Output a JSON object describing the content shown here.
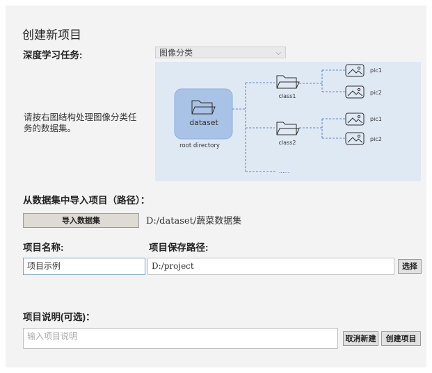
{
  "page_title": "创建新项目",
  "task": {
    "label": "深度学习任务:",
    "selected": "图像分类"
  },
  "hint_text_line1": "请按右图结构处理图像分类任",
  "hint_text_line2": "务的数据集。",
  "diagram": {
    "root_label": "dataset",
    "root_caption": "root directory",
    "class1": "class1",
    "class2": "class2",
    "more": "......",
    "pic1_a": "pic1",
    "pic2_a": "pic2",
    "pic1_b": "pic1",
    "pic2_b": "pic2"
  },
  "import": {
    "label": "从数据集中导入项目（路径）：",
    "button": "导入数据集",
    "path": "D:/dataset/蔬菜数据集"
  },
  "name": {
    "label": "项目名称:",
    "value": "项目示例"
  },
  "save_path": {
    "label": "项目保存路径:",
    "value": "D:/project",
    "choose_button": "选择"
  },
  "description": {
    "label": "项目说明(可选)：",
    "placeholder": "输入项目说明"
  },
  "actions": {
    "cancel": "取消新建",
    "create": "创建项目"
  },
  "colors": {
    "panel_bg": "#f3f3f3",
    "diagram_bg": "#dfe9f4",
    "root_box": "#a9c3e6",
    "dashed_line": "#3a66b0"
  }
}
